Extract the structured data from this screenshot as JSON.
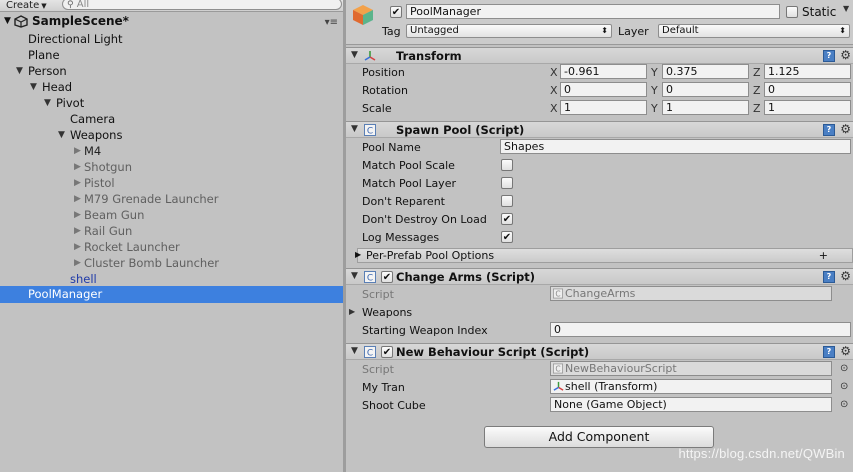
{
  "hierarchy": {
    "create_label": "Create",
    "search_placeholder": "All",
    "scene_name": "SampleScene*",
    "items": [
      {
        "label": "Directional Light"
      },
      {
        "label": "Plane"
      },
      {
        "label": "Person"
      },
      {
        "label": "Head"
      },
      {
        "label": "Pivot"
      },
      {
        "label": "Camera"
      },
      {
        "label": "Weapons"
      },
      {
        "label": "M4"
      },
      {
        "label": "Shotgun"
      },
      {
        "label": "Pistol"
      },
      {
        "label": "M79 Grenade Launcher"
      },
      {
        "label": "Beam Gun"
      },
      {
        "label": "Rail Gun"
      },
      {
        "label": "Rocket Launcher"
      },
      {
        "label": "Cluster Bomb Launcher"
      },
      {
        "label": "shell"
      },
      {
        "label": "PoolManager"
      }
    ]
  },
  "inspector": {
    "object_name": "PoolManager",
    "active": true,
    "static_label": "Static",
    "static": false,
    "tag_label": "Tag",
    "tag_value": "Untagged",
    "layer_label": "Layer",
    "layer_value": "Default",
    "transform": {
      "title": "Transform",
      "position_label": "Position",
      "rotation_label": "Rotation",
      "scale_label": "Scale",
      "axis_x": "X",
      "axis_y": "Y",
      "axis_z": "Z",
      "position": {
        "x": "-0.961",
        "y": "0.375",
        "z": "1.125"
      },
      "rotation": {
        "x": "0",
        "y": "0",
        "z": "0"
      },
      "scale": {
        "x": "1",
        "y": "1",
        "z": "1"
      }
    },
    "spawn_pool": {
      "title": "Spawn Pool (Script)",
      "pool_name_label": "Pool Name",
      "pool_name_value": "Shapes",
      "match_scale_label": "Match Pool Scale",
      "match_scale": false,
      "match_layer_label": "Match Pool Layer",
      "match_layer": false,
      "dont_reparent_label": "Don't Reparent",
      "dont_reparent": false,
      "dont_destroy_label": "Don't Destroy On Load",
      "dont_destroy": true,
      "log_messages_label": "Log Messages",
      "log_messages": true,
      "per_prefab_label": "Per-Prefab Pool Options",
      "add_label": "+"
    },
    "change_arms": {
      "title": "Change Arms (Script)",
      "script_label": "Script",
      "script_value": "ChangeArms",
      "weapons_label": "Weapons",
      "start_index_label": "Starting Weapon Index",
      "start_index_value": "0"
    },
    "new_behaviour": {
      "title": "New Behaviour Script (Script)",
      "script_label": "Script",
      "script_value": "NewBehaviourScript",
      "my_tran_label": "My Tran",
      "my_tran_value": "shell (Transform)",
      "shoot_cube_label": "Shoot Cube",
      "shoot_cube_value": "None (Game Object)"
    },
    "add_component_label": "Add Component"
  },
  "watermark": "https://blog.csdn.net/QWBin",
  "colors": {
    "selection": "#3d80df",
    "panel": "#c2c2c2"
  }
}
